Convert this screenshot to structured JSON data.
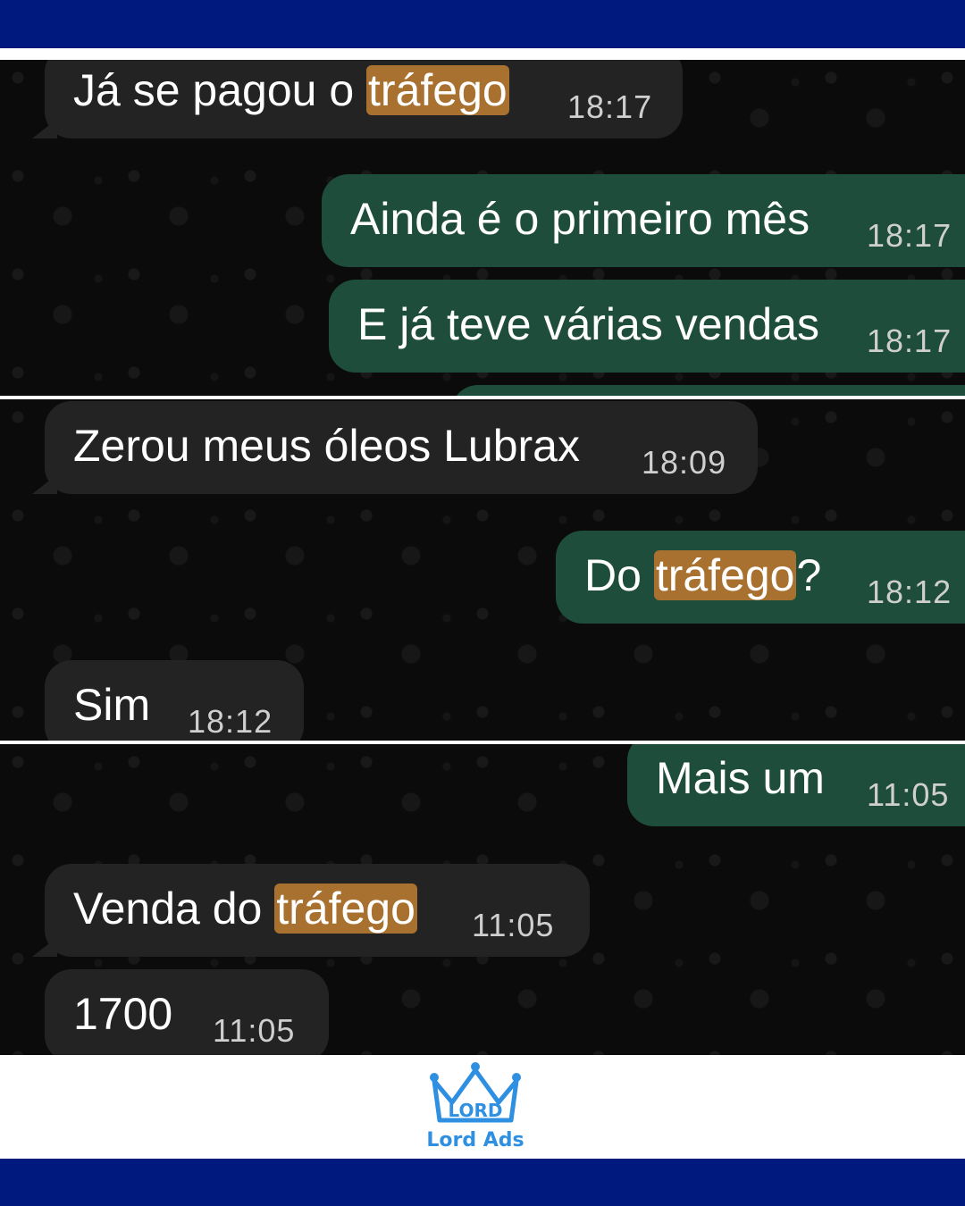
{
  "messages": [
    {
      "parts": [
        {
          "t": "Já se pagou o "
        },
        {
          "t": "tráfego",
          "h": true
        }
      ],
      "time": "18:17"
    },
    {
      "text": "Ainda é o primeiro mês",
      "time": "18:17"
    },
    {
      "text": "E já teve várias vendas",
      "time": "18:17"
    },
    {
      "text": "Zerou meus óleos Lubrax",
      "time": "18:09"
    },
    {
      "parts": [
        {
          "t": "Do "
        },
        {
          "t": "tráfego",
          "h": true
        },
        {
          "t": "?"
        }
      ],
      "time": "18:12"
    },
    {
      "text": "Sim",
      "time": "18:12"
    },
    {
      "text": "Mais um",
      "time": "11:05"
    },
    {
      "parts": [
        {
          "t": "Venda do "
        },
        {
          "t": "tráfego",
          "h": true
        }
      ],
      "time": "11:05"
    },
    {
      "text": "1700",
      "time": "11:05"
    }
  ],
  "brand": {
    "name": "Lord Ads",
    "logo_word": "LORD"
  },
  "colors": {
    "frame": "#00197e",
    "incoming": "#232323",
    "outgoing": "#1e4d3b",
    "highlight": "#a8712f",
    "logo": "#2f8fe0"
  }
}
